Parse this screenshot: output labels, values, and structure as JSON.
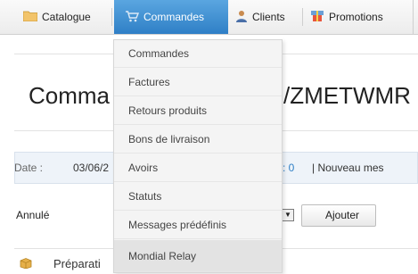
{
  "nav": {
    "tabs": [
      {
        "label": "Catalogue",
        "icon": "folder-icon"
      },
      {
        "label": "Commandes",
        "icon": "cart-icon"
      },
      {
        "label": "Clients",
        "icon": "user-icon"
      },
      {
        "label": "Promotions",
        "icon": "discount-icon"
      }
    ],
    "active_color": "#3a8ad2"
  },
  "dropdown": {
    "items": [
      "Commandes",
      "Factures",
      "Retours produits",
      "Bons de livraison",
      "Avoirs",
      "Statuts",
      "Messages prédéfinis",
      "Mondial Relay"
    ]
  },
  "page": {
    "title": "Comma",
    "reference": "/ZMETWMR"
  },
  "info": {
    "date_label": "Date :",
    "date_value": "03/06/2",
    "messages_count": ": 0",
    "new_message_link": "|   Nouveau mes"
  },
  "status_form": {
    "selected_status": "Annulé",
    "add_button": "Ajouter"
  },
  "section": {
    "title": "Préparati"
  }
}
